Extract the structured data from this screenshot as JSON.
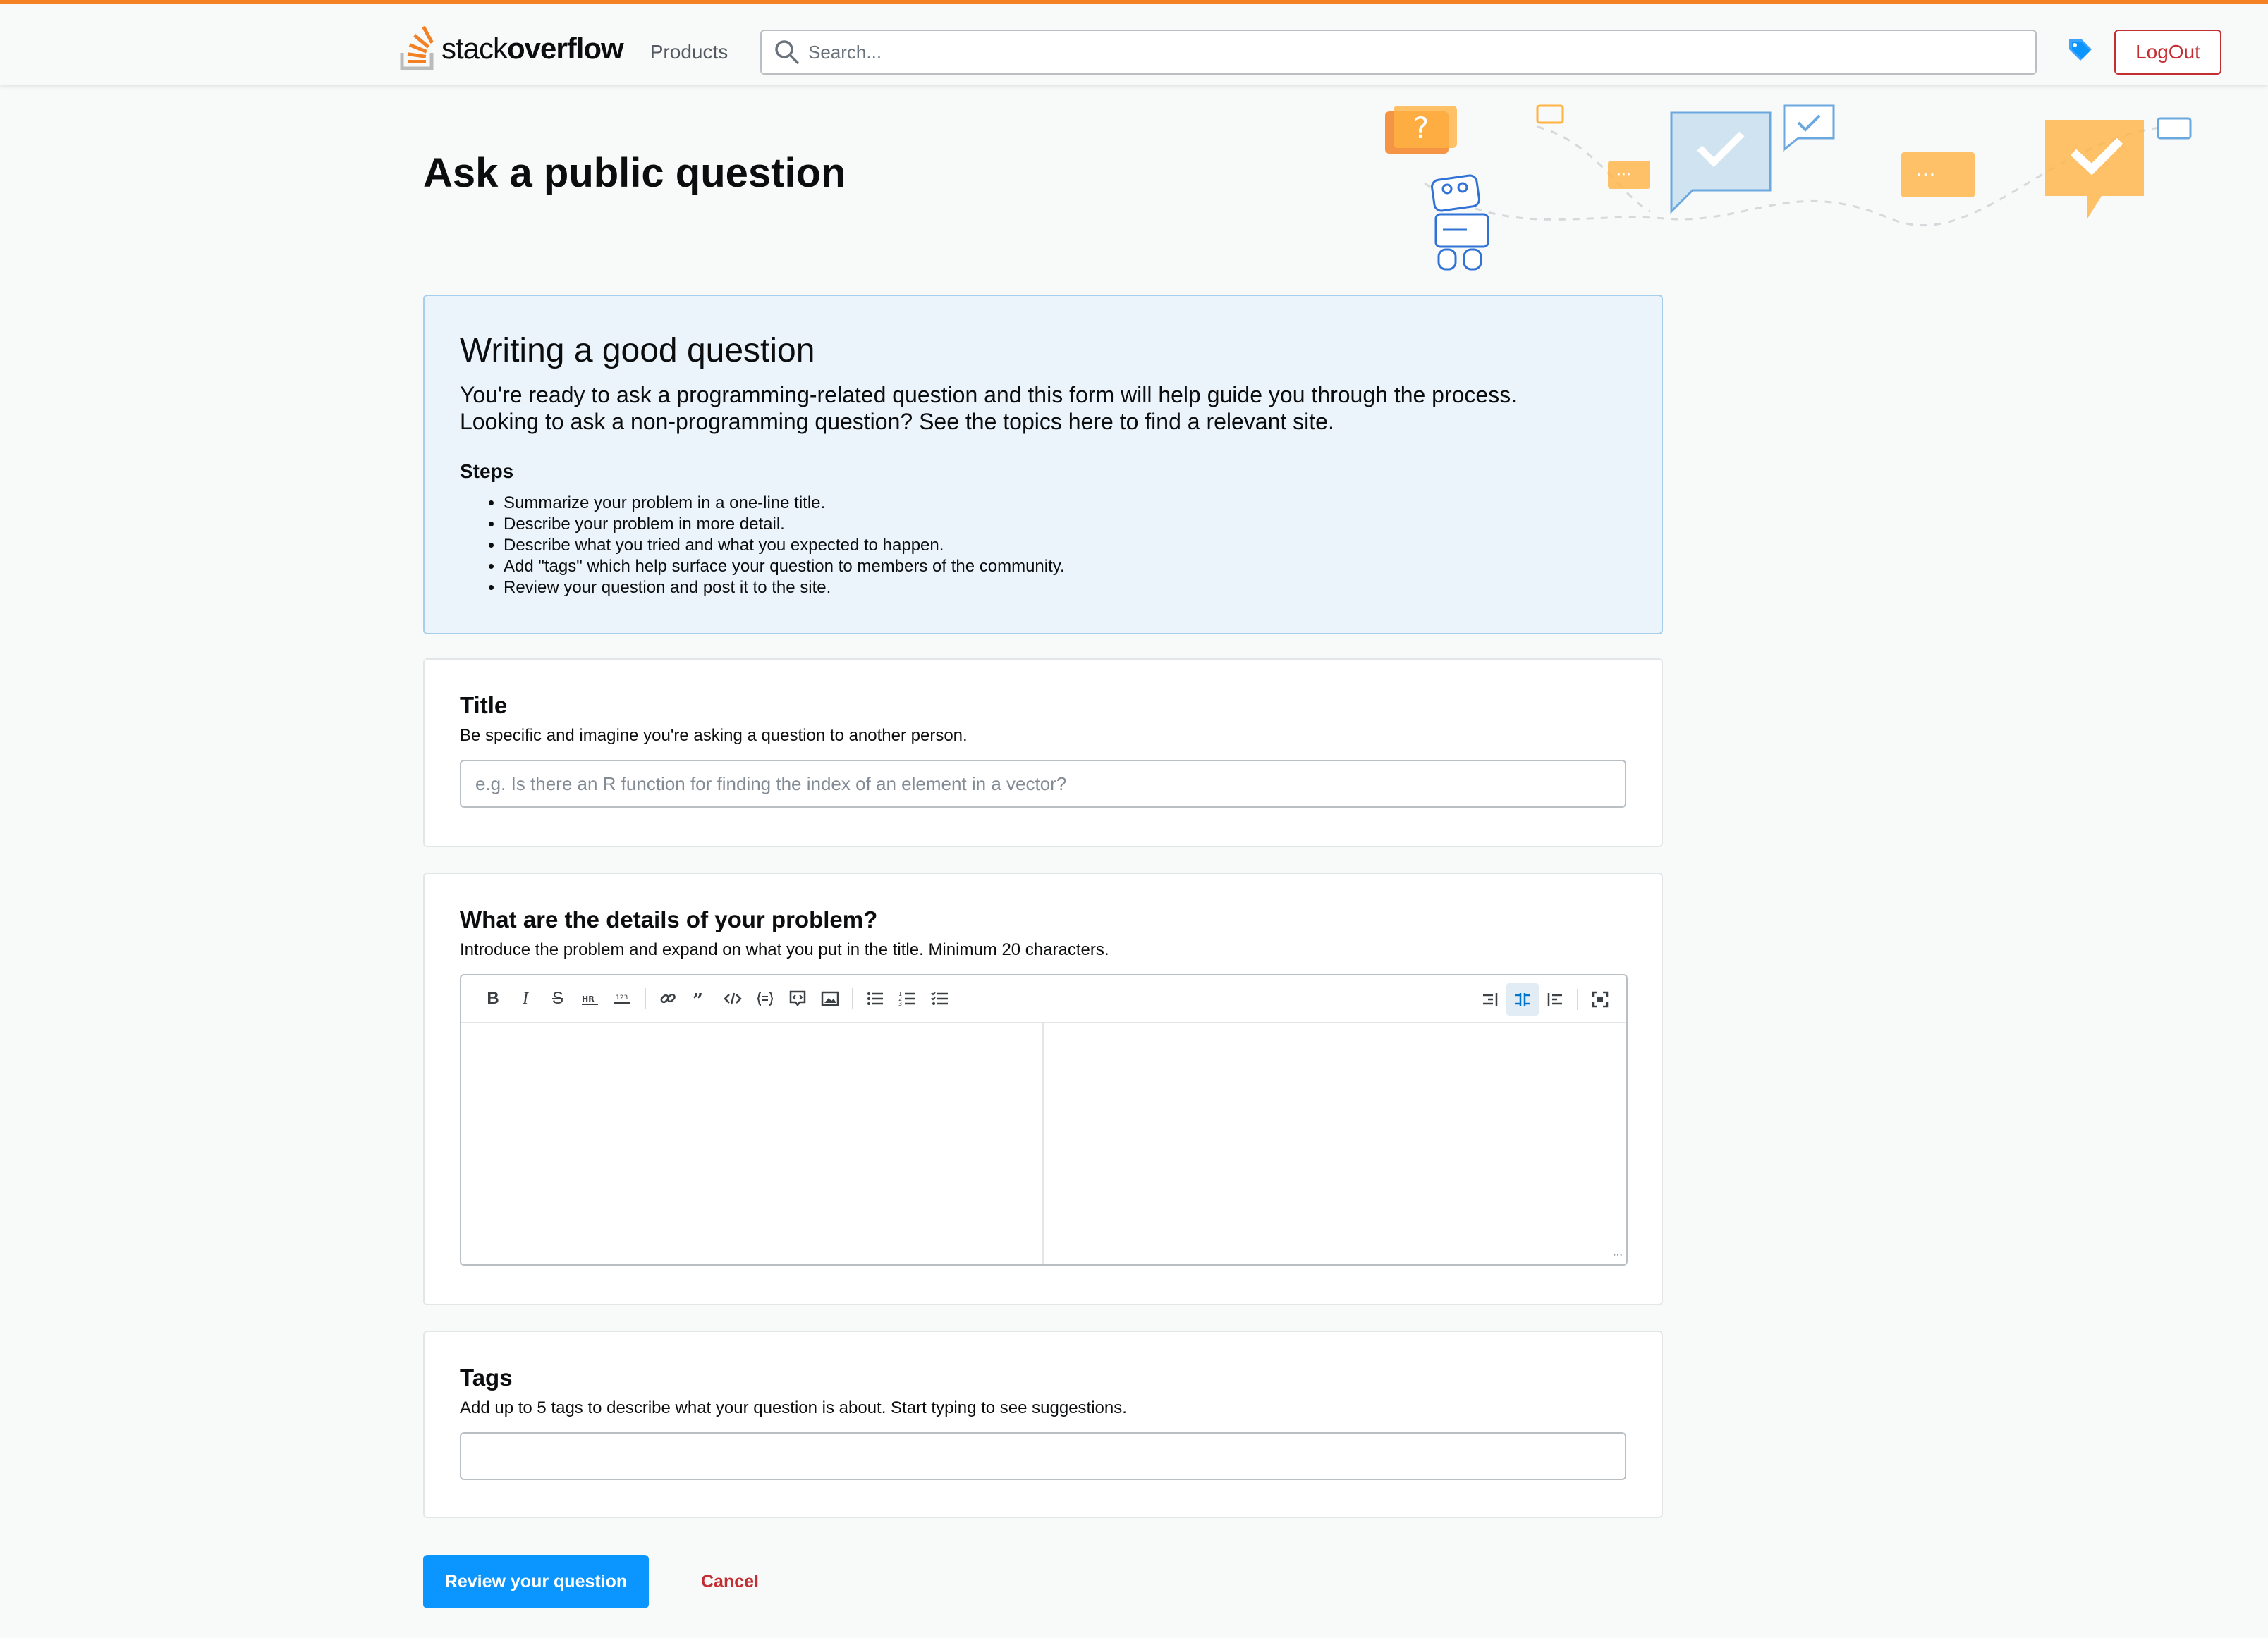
{
  "header": {
    "logo_light": "stack",
    "logo_bold": "overflow",
    "products_label": "Products",
    "search_placeholder": "Search...",
    "logout_label": "LogOut"
  },
  "page": {
    "title": "Ask a public question"
  },
  "notice": {
    "heading": "Writing a good question",
    "intro_line1": "You're ready to ask a programming-related question and this form will help guide you through the process.",
    "intro_line2": "Looking to ask a non-programming question? See the topics here to find a relevant site.",
    "steps_heading": "Steps",
    "steps": [
      "Summarize your problem in a one-line title.",
      "Describe your problem in more detail.",
      "Describe what you tried and what you expected to happen.",
      "Add \"tags\" which help surface your question to members of the community.",
      "Review your question and post it to the site."
    ]
  },
  "title_card": {
    "label": "Title",
    "description": "Be specific and imagine you're asking a question to another person.",
    "placeholder": "e.g. Is there an R function for finding the index of an element in a vector?",
    "value": ""
  },
  "details_card": {
    "label": "What are the details of your problem?",
    "description": "Introduce the problem and expand on what you put in the title. Minimum 20 characters.",
    "toolbar": {
      "bold": "B",
      "italic": "I",
      "strike": "S"
    },
    "body": ""
  },
  "tags_card": {
    "label": "Tags",
    "description": "Add up to 5 tags to describe what your question is about. Start typing to see suggestions.",
    "value": ""
  },
  "actions": {
    "review_label": "Review your question",
    "cancel_label": "Cancel"
  },
  "colors": {
    "accent_orange": "#f48225",
    "primary_blue": "#0a95ff",
    "danger_red": "#c22e32",
    "notice_bg": "#ebf4fb"
  }
}
